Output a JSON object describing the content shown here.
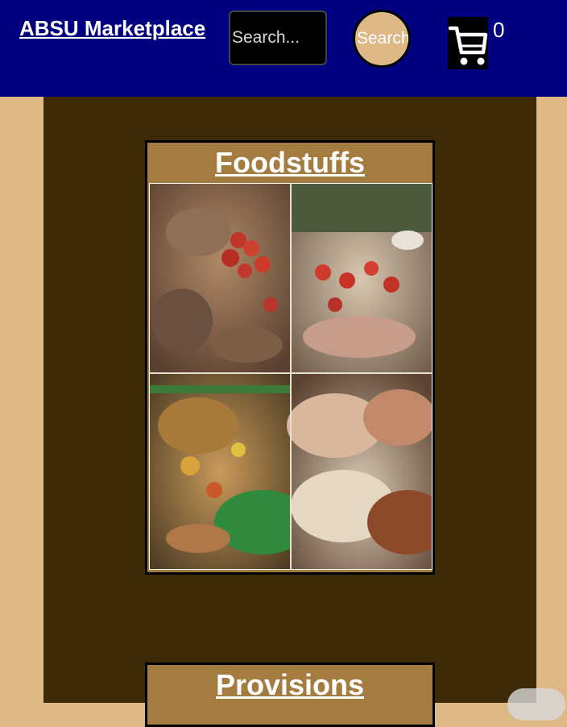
{
  "header": {
    "brand": "ABSU Marketplace",
    "search_placeholder": "Search...",
    "search_button_label": "Search",
    "cart_count": "0",
    "cart_icon": "shopping-cart-icon"
  },
  "categories": [
    {
      "title": "Foodstuffs",
      "image": "foodstuffs-market-photo"
    },
    {
      "title": "Provisions"
    }
  ],
  "colors": {
    "header_bg": "#000080",
    "page_bg": "#deb887",
    "main_bg": "#3d2b07",
    "card_bg": "#a57c3f"
  }
}
